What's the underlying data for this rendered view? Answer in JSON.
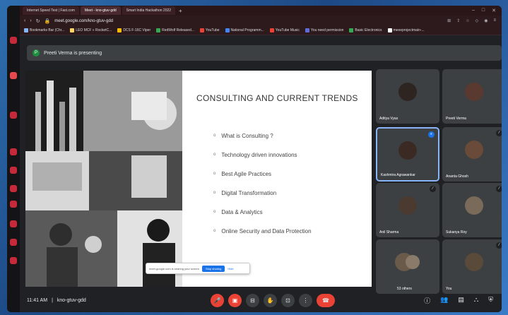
{
  "tabs": [
    {
      "label": "Internet Speed Test | Fast.com",
      "active": false
    },
    {
      "label": "Meet - kno-gtuv-gdd",
      "active": true
    },
    {
      "label": "Smart India Hackathon 2022",
      "active": false
    }
  ],
  "address": {
    "url": "meet.google.com/kno-gtuv-gdd"
  },
  "bookmarks": [
    {
      "label": "Bookmarks Bar (Chr...",
      "color": "#8ab4f8"
    },
    {
      "label": "LEO MCF » RocketC...",
      "color": "#fdd663"
    },
    {
      "label": "DCS F-16C Viper",
      "color": "#fbbc04"
    },
    {
      "label": "RedWolf Released...",
      "color": "#34a853"
    },
    {
      "label": "YouTube",
      "color": "#ea4335"
    },
    {
      "label": "National Programm...",
      "color": "#4285f4"
    },
    {
      "label": "YouTube Music",
      "color": "#ea4335"
    },
    {
      "label": "You need permission",
      "color": "#5f6bd8"
    },
    {
      "label": "Basic Electronics",
      "color": "#34a853"
    },
    {
      "label": "meeeprojectmain-...",
      "color": "#ffffff"
    }
  ],
  "presenter": {
    "initial": "P",
    "text": "Preeti Verma is presenting"
  },
  "slide": {
    "title": "CONSULTING AND CURRENT TRENDS",
    "bullets": [
      "What is Consulting ?",
      "Technology driven innovations",
      "Best Agile Practices",
      "Digital Transformation",
      "Data & Analytics",
      "Online Security and Data Protection"
    ]
  },
  "share_popup": {
    "text": "meet.google.com is sharing your screen",
    "stop": "Stop sharing",
    "hide": "Hide"
  },
  "participants": [
    {
      "name": "Aditya Vyas",
      "bg": "#6b5a48",
      "av": "#3a2e28"
    },
    {
      "name": "Preeti Verma",
      "bg": "#9a7a66",
      "av": "#5a3a30"
    },
    {
      "name": "Kashmira Agrawankar",
      "bg": "#5a4a40",
      "av": "#3b2a24"
    },
    {
      "name": "Ananta Ghosh",
      "bg": "#b08a6a",
      "av": "#6a4a38"
    },
    {
      "name": "Anil Sharma",
      "bg": "#c8c0b0",
      "av": "#4a3a30"
    },
    {
      "name": "Sukanya Roy",
      "bg": "#3c4043",
      "av": "#7a6a5a"
    },
    {
      "name": "53 others",
      "bg": "#3c4043",
      "av": "#6a5a4a"
    },
    {
      "name": "You",
      "bg": "#3c4043",
      "av": "#5a4a3a"
    }
  ],
  "footer": {
    "time": "11:41 AM",
    "meeting_code": "kno-gtuv-gdd"
  },
  "controls": [
    "mic-off",
    "camera-off",
    "captions",
    "raise-hand",
    "present",
    "more",
    "end-call"
  ]
}
